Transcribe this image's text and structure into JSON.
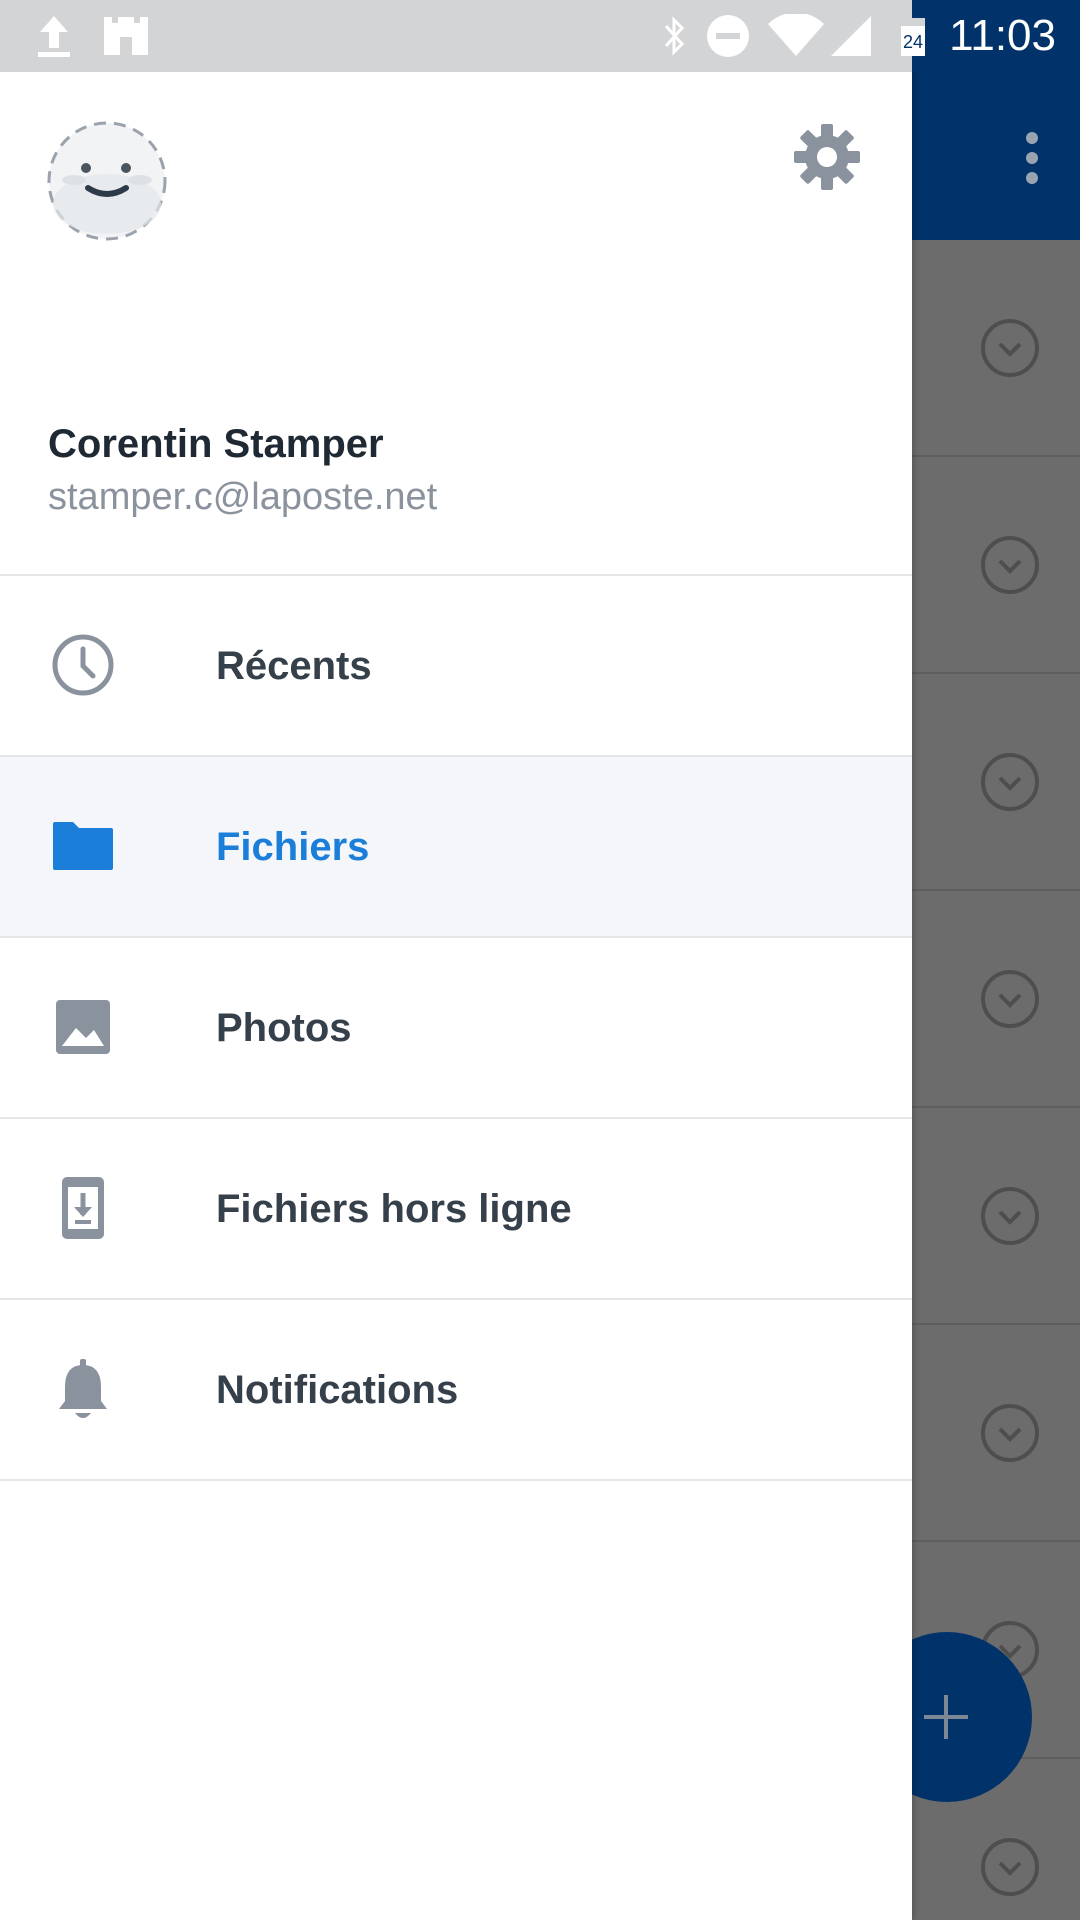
{
  "status_bar": {
    "time": "11:03",
    "icons": [
      "upload-icon",
      "castle-app-icon",
      "bluetooth-icon",
      "do-not-disturb-icon",
      "wifi-icon",
      "cell-signal-icon",
      "calendar-24-icon"
    ],
    "calendar_day": "24"
  },
  "drawer": {
    "user": {
      "name": "Corentin Stamper",
      "email": "stamper.c@laposte.net"
    },
    "items": [
      {
        "label": "Récents",
        "icon": "clock-icon",
        "active": false
      },
      {
        "label": "Fichiers",
        "icon": "folder-icon",
        "active": true
      },
      {
        "label": "Photos",
        "icon": "image-icon",
        "active": false
      },
      {
        "label": "Fichiers hors ligne",
        "icon": "offline-phone-icon",
        "active": false
      },
      {
        "label": "Notifications",
        "icon": "bell-icon",
        "active": false
      }
    ]
  },
  "colors": {
    "accent": "#1b7fd9",
    "toolbar": "#01326a",
    "icon_grey": "#8a939d"
  }
}
